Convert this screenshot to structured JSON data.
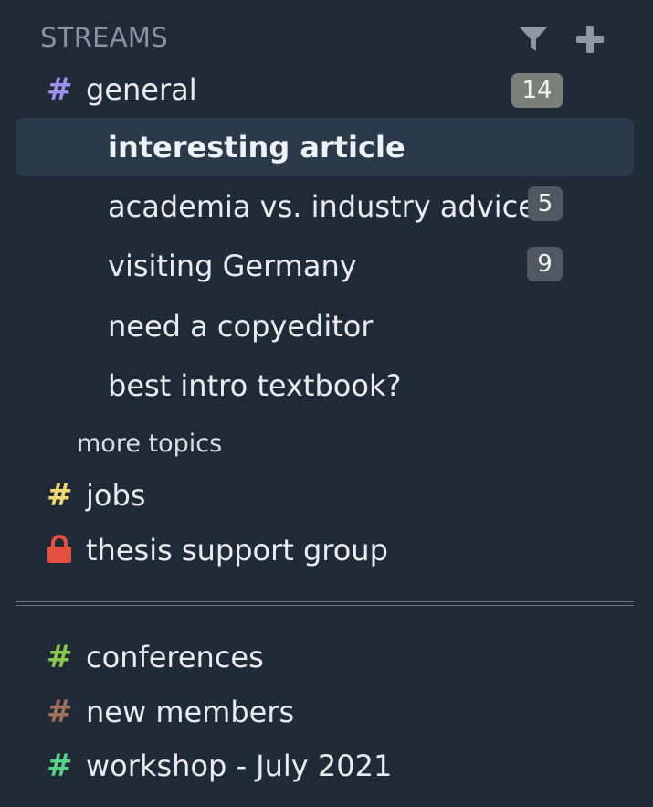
{
  "header": {
    "title": "STREAMS",
    "filter_icon": "filter-icon",
    "add_icon": "plus-icon"
  },
  "streams_pinned": [
    {
      "name": "general",
      "icon": "hash",
      "color": "#9b8ff0",
      "unread": "14"
    },
    {
      "name": "jobs",
      "icon": "hash",
      "color": "#f4d870",
      "unread": ""
    },
    {
      "name": "thesis support group",
      "icon": "lock",
      "color": "#e3513f",
      "unread": ""
    }
  ],
  "topics": [
    {
      "name": "interesting article",
      "unread": "",
      "active": true
    },
    {
      "name": "academia vs. industry advice?",
      "unread": "5",
      "active": false
    },
    {
      "name": "visiting Germany",
      "unread": "9",
      "active": false
    },
    {
      "name": "need a copyeditor",
      "unread": "",
      "active": false
    },
    {
      "name": "best intro textbook?",
      "unread": "",
      "active": false
    }
  ],
  "more_topics_label": "more topics",
  "streams_other": [
    {
      "name": "conferences",
      "icon": "hash",
      "color": "#87c94a"
    },
    {
      "name": "new members",
      "icon": "hash",
      "color": "#a26f5b"
    },
    {
      "name": "workshop - July 2021",
      "icon": "hash",
      "color": "#55d387"
    }
  ],
  "colors": {
    "background": "#212b38",
    "active_topic_bg": "#2b3a4a",
    "badge_bright": "#7a7f7a",
    "badge_muted": "#505861"
  }
}
